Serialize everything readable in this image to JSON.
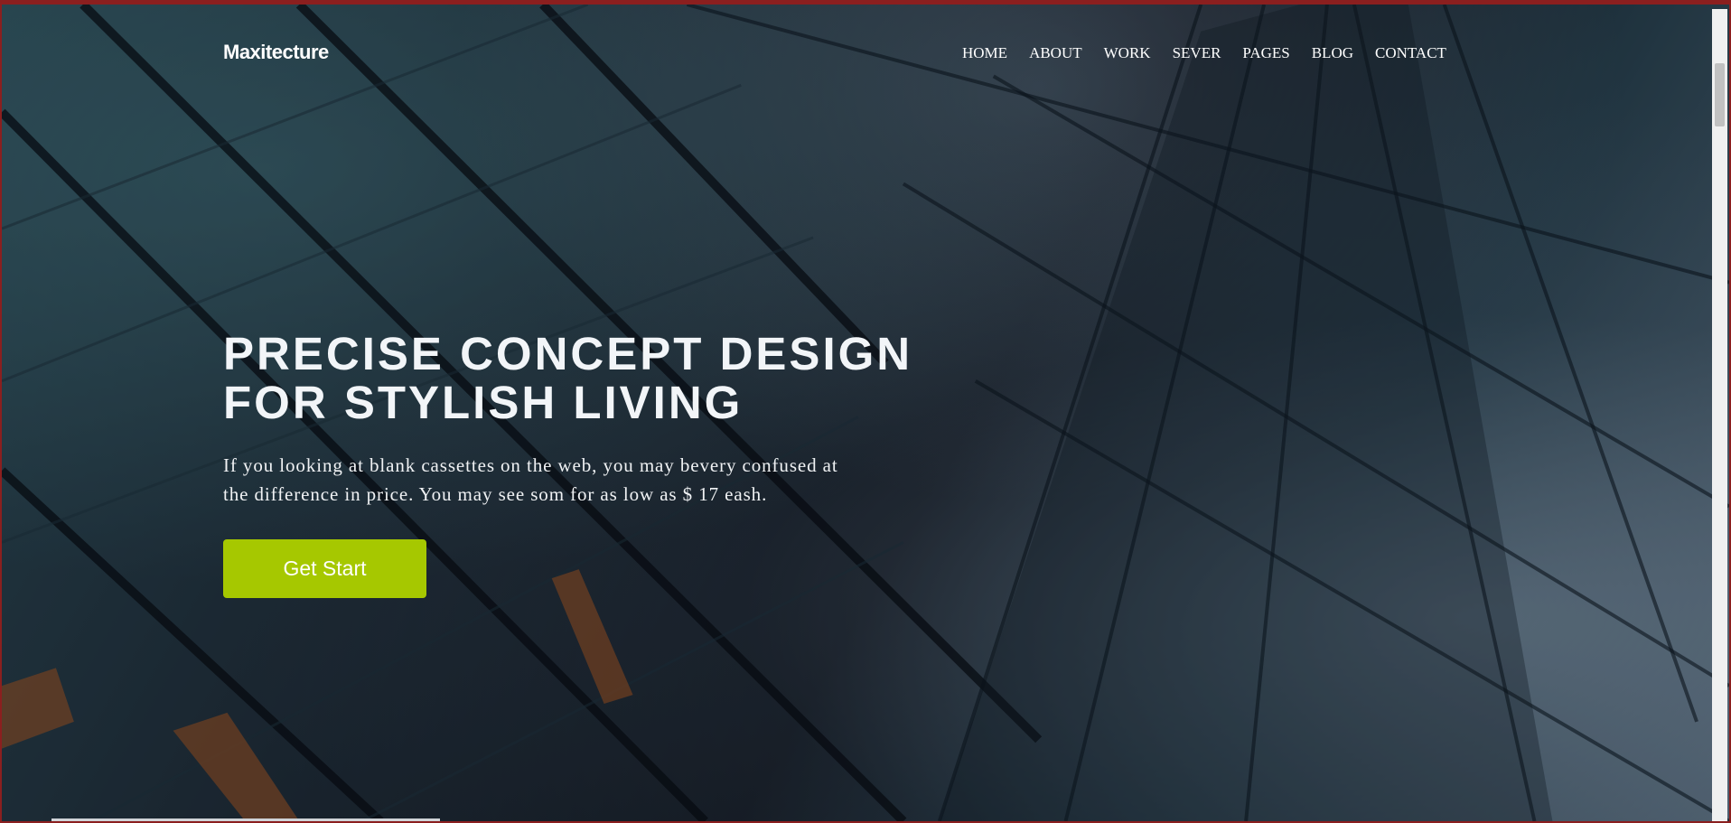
{
  "brand": {
    "name": "Maxitecture"
  },
  "nav": {
    "items": [
      "HOME",
      "ABOUT",
      "WORK",
      "SEVER",
      "PAGES",
      "BLOG",
      "CONTACT"
    ]
  },
  "hero": {
    "headline_line1": "PRECISE CONCEPT DESIGN",
    "headline_line2": "FOR STYLISH LIVING",
    "description_line1": "If you looking at blank cassettes on the web, you may bevery confused at",
    "description_line2": "the difference in price. You may see som for as low as $ 17 eash.",
    "cta_label": "Get Start"
  },
  "colors": {
    "accent": "#a6c800",
    "text": "#ffffff",
    "window_border": "#8b1f1f"
  }
}
